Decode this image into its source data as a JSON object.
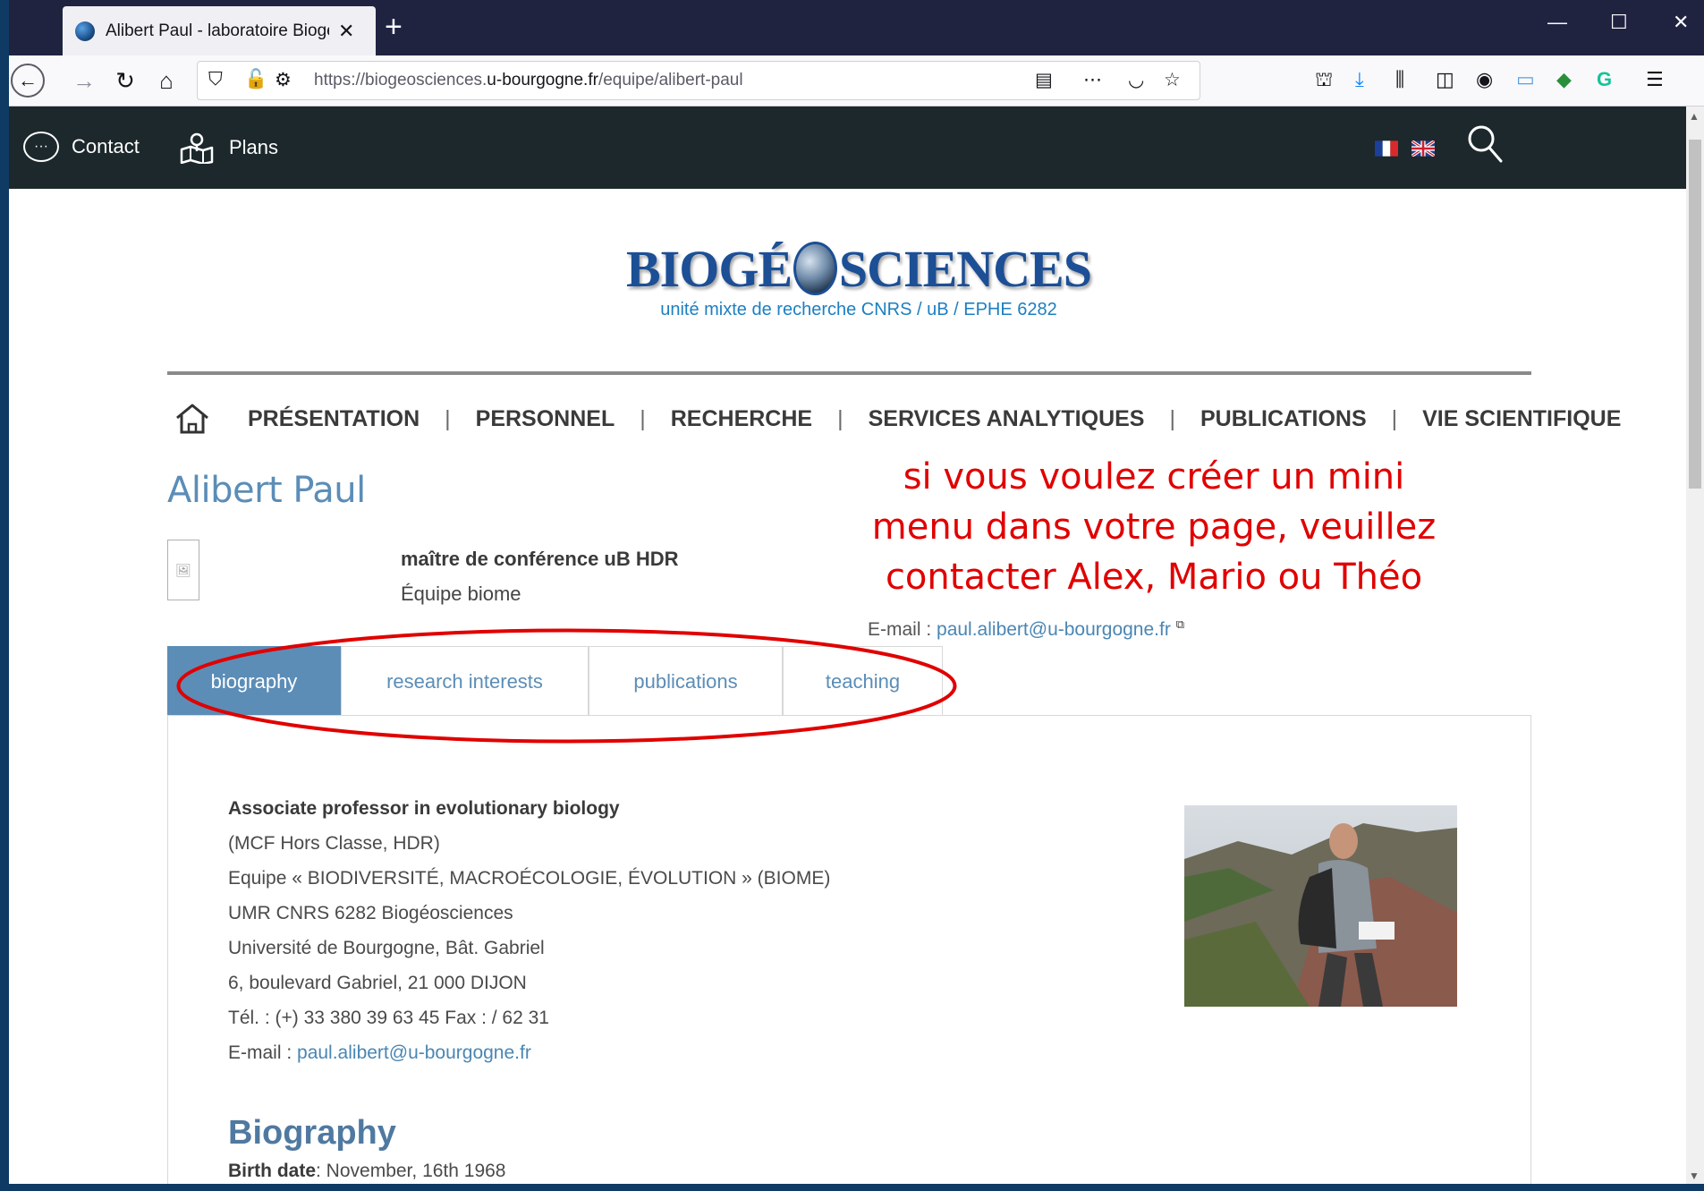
{
  "browser": {
    "tab_title": "Alibert Paul - laboratoire Biogé",
    "url_prefix": "https://biogeosciences.",
    "url_domain": "u-bourgogne.fr",
    "url_path": "/equipe/alibert-paul"
  },
  "sitebar": {
    "contact_label": "Contact",
    "plans_label": "Plans"
  },
  "header": {
    "logo_left": "BIOGÉ",
    "logo_right": "SCIENCES",
    "subtitle": "unité mixte de recherche CNRS / uB / EPHE 6282"
  },
  "nav": {
    "items": [
      {
        "label": "PRÉSENTATION"
      },
      {
        "label": "PERSONNEL"
      },
      {
        "label": "RECHERCHE"
      },
      {
        "label": "SERVICES ANALYTIQUES"
      },
      {
        "label": "PUBLICATIONS"
      },
      {
        "label": "VIE SCIENTIFIQUE"
      }
    ],
    "separator": "|"
  },
  "person": {
    "name": "Alibert Paul",
    "role": "maître de conférence uB HDR",
    "team": "Équipe biome",
    "email_label": "E-mail : ",
    "email": "paul.alibert@u-bourgogne.fr"
  },
  "annotation": {
    "line1": "si vous voulez créer un mini",
    "line2": "menu dans votre page, veuillez",
    "line3": "contacter Alex, Mario ou Théo",
    "color": "#e00000"
  },
  "tabs": [
    {
      "label": "biography",
      "active": true
    },
    {
      "label": "research interests"
    },
    {
      "label": "publications"
    },
    {
      "label": "teaching"
    }
  ],
  "bio_block": {
    "title": "Associate professor in evolutionary biology",
    "lines": [
      "(MCF Hors Classe, HDR)",
      "Equipe « BIODIVERSITÉ, MACROÉCOLOGIE, ÉVOLUTION » (BIOME)",
      "UMR CNRS 6282 Biogéosciences",
      "Université de Bourgogne, Bât. Gabriel",
      "6, boulevard Gabriel, 21 000 DIJON",
      "Tél. : (+) 33 380 39 63 45 Fax : / 62 31"
    ],
    "email_label": "E-mail : ",
    "email": "paul.alibert@u-bourgogne.fr"
  },
  "biography": {
    "heading": "Biography",
    "birth_label": "Birth date",
    "birth_value": ": November, 16th 1968"
  },
  "colors": {
    "accent": "#5b8db7",
    "sitebar": "#1c282c",
    "logo": "#1c4f95"
  }
}
